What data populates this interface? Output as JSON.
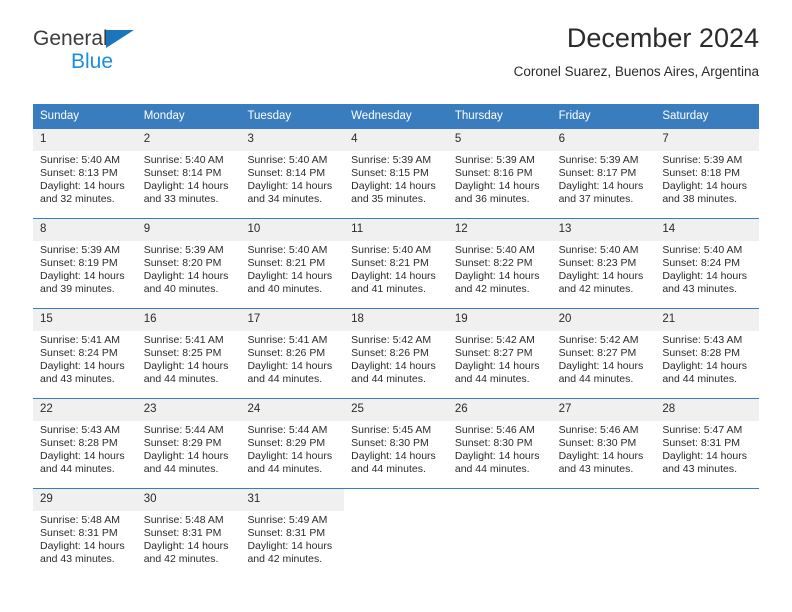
{
  "logo": {
    "word_one": "General",
    "word_two": "Blue",
    "triangle_icon": "triangle-icon",
    "accent_dark": "#3c3c3c",
    "accent_blue": "#1b8ede"
  },
  "header": {
    "title": "December 2024",
    "subtitle": "Coronel Suarez, Buenos Aires, Argentina"
  },
  "colors": {
    "header_blue": "#3a7dbf",
    "day_number_bg": "#f0f0f0",
    "text": "#2b2b2b"
  },
  "calendar": {
    "weekdays": [
      "Sunday",
      "Monday",
      "Tuesday",
      "Wednesday",
      "Thursday",
      "Friday",
      "Saturday"
    ],
    "labels": {
      "sunrise": "Sunrise:",
      "sunset": "Sunset:",
      "daylight": "Daylight:"
    },
    "weeks": [
      [
        {
          "day": "1",
          "sunrise": "Sunrise: 5:40 AM",
          "sunset": "Sunset: 8:13 PM",
          "daylight_line1": "Daylight: 14 hours",
          "daylight_line2": "and 32 minutes."
        },
        {
          "day": "2",
          "sunrise": "Sunrise: 5:40 AM",
          "sunset": "Sunset: 8:14 PM",
          "daylight_line1": "Daylight: 14 hours",
          "daylight_line2": "and 33 minutes."
        },
        {
          "day": "3",
          "sunrise": "Sunrise: 5:40 AM",
          "sunset": "Sunset: 8:14 PM",
          "daylight_line1": "Daylight: 14 hours",
          "daylight_line2": "and 34 minutes."
        },
        {
          "day": "4",
          "sunrise": "Sunrise: 5:39 AM",
          "sunset": "Sunset: 8:15 PM",
          "daylight_line1": "Daylight: 14 hours",
          "daylight_line2": "and 35 minutes."
        },
        {
          "day": "5",
          "sunrise": "Sunrise: 5:39 AM",
          "sunset": "Sunset: 8:16 PM",
          "daylight_line1": "Daylight: 14 hours",
          "daylight_line2": "and 36 minutes."
        },
        {
          "day": "6",
          "sunrise": "Sunrise: 5:39 AM",
          "sunset": "Sunset: 8:17 PM",
          "daylight_line1": "Daylight: 14 hours",
          "daylight_line2": "and 37 minutes."
        },
        {
          "day": "7",
          "sunrise": "Sunrise: 5:39 AM",
          "sunset": "Sunset: 8:18 PM",
          "daylight_line1": "Daylight: 14 hours",
          "daylight_line2": "and 38 minutes."
        }
      ],
      [
        {
          "day": "8",
          "sunrise": "Sunrise: 5:39 AM",
          "sunset": "Sunset: 8:19 PM",
          "daylight_line1": "Daylight: 14 hours",
          "daylight_line2": "and 39 minutes."
        },
        {
          "day": "9",
          "sunrise": "Sunrise: 5:39 AM",
          "sunset": "Sunset: 8:20 PM",
          "daylight_line1": "Daylight: 14 hours",
          "daylight_line2": "and 40 minutes."
        },
        {
          "day": "10",
          "sunrise": "Sunrise: 5:40 AM",
          "sunset": "Sunset: 8:21 PM",
          "daylight_line1": "Daylight: 14 hours",
          "daylight_line2": "and 40 minutes."
        },
        {
          "day": "11",
          "sunrise": "Sunrise: 5:40 AM",
          "sunset": "Sunset: 8:21 PM",
          "daylight_line1": "Daylight: 14 hours",
          "daylight_line2": "and 41 minutes."
        },
        {
          "day": "12",
          "sunrise": "Sunrise: 5:40 AM",
          "sunset": "Sunset: 8:22 PM",
          "daylight_line1": "Daylight: 14 hours",
          "daylight_line2": "and 42 minutes."
        },
        {
          "day": "13",
          "sunrise": "Sunrise: 5:40 AM",
          "sunset": "Sunset: 8:23 PM",
          "daylight_line1": "Daylight: 14 hours",
          "daylight_line2": "and 42 minutes."
        },
        {
          "day": "14",
          "sunrise": "Sunrise: 5:40 AM",
          "sunset": "Sunset: 8:24 PM",
          "daylight_line1": "Daylight: 14 hours",
          "daylight_line2": "and 43 minutes."
        }
      ],
      [
        {
          "day": "15",
          "sunrise": "Sunrise: 5:41 AM",
          "sunset": "Sunset: 8:24 PM",
          "daylight_line1": "Daylight: 14 hours",
          "daylight_line2": "and 43 minutes."
        },
        {
          "day": "16",
          "sunrise": "Sunrise: 5:41 AM",
          "sunset": "Sunset: 8:25 PM",
          "daylight_line1": "Daylight: 14 hours",
          "daylight_line2": "and 44 minutes."
        },
        {
          "day": "17",
          "sunrise": "Sunrise: 5:41 AM",
          "sunset": "Sunset: 8:26 PM",
          "daylight_line1": "Daylight: 14 hours",
          "daylight_line2": "and 44 minutes."
        },
        {
          "day": "18",
          "sunrise": "Sunrise: 5:42 AM",
          "sunset": "Sunset: 8:26 PM",
          "daylight_line1": "Daylight: 14 hours",
          "daylight_line2": "and 44 minutes."
        },
        {
          "day": "19",
          "sunrise": "Sunrise: 5:42 AM",
          "sunset": "Sunset: 8:27 PM",
          "daylight_line1": "Daylight: 14 hours",
          "daylight_line2": "and 44 minutes."
        },
        {
          "day": "20",
          "sunrise": "Sunrise: 5:42 AM",
          "sunset": "Sunset: 8:27 PM",
          "daylight_line1": "Daylight: 14 hours",
          "daylight_line2": "and 44 minutes."
        },
        {
          "day": "21",
          "sunrise": "Sunrise: 5:43 AM",
          "sunset": "Sunset: 8:28 PM",
          "daylight_line1": "Daylight: 14 hours",
          "daylight_line2": "and 44 minutes."
        }
      ],
      [
        {
          "day": "22",
          "sunrise": "Sunrise: 5:43 AM",
          "sunset": "Sunset: 8:28 PM",
          "daylight_line1": "Daylight: 14 hours",
          "daylight_line2": "and 44 minutes."
        },
        {
          "day": "23",
          "sunrise": "Sunrise: 5:44 AM",
          "sunset": "Sunset: 8:29 PM",
          "daylight_line1": "Daylight: 14 hours",
          "daylight_line2": "and 44 minutes."
        },
        {
          "day": "24",
          "sunrise": "Sunrise: 5:44 AM",
          "sunset": "Sunset: 8:29 PM",
          "daylight_line1": "Daylight: 14 hours",
          "daylight_line2": "and 44 minutes."
        },
        {
          "day": "25",
          "sunrise": "Sunrise: 5:45 AM",
          "sunset": "Sunset: 8:30 PM",
          "daylight_line1": "Daylight: 14 hours",
          "daylight_line2": "and 44 minutes."
        },
        {
          "day": "26",
          "sunrise": "Sunrise: 5:46 AM",
          "sunset": "Sunset: 8:30 PM",
          "daylight_line1": "Daylight: 14 hours",
          "daylight_line2": "and 44 minutes."
        },
        {
          "day": "27",
          "sunrise": "Sunrise: 5:46 AM",
          "sunset": "Sunset: 8:30 PM",
          "daylight_line1": "Daylight: 14 hours",
          "daylight_line2": "and 43 minutes."
        },
        {
          "day": "28",
          "sunrise": "Sunrise: 5:47 AM",
          "sunset": "Sunset: 8:31 PM",
          "daylight_line1": "Daylight: 14 hours",
          "daylight_line2": "and 43 minutes."
        }
      ],
      [
        {
          "day": "29",
          "sunrise": "Sunrise: 5:48 AM",
          "sunset": "Sunset: 8:31 PM",
          "daylight_line1": "Daylight: 14 hours",
          "daylight_line2": "and 43 minutes."
        },
        {
          "day": "30",
          "sunrise": "Sunrise: 5:48 AM",
          "sunset": "Sunset: 8:31 PM",
          "daylight_line1": "Daylight: 14 hours",
          "daylight_line2": "and 42 minutes."
        },
        {
          "day": "31",
          "sunrise": "Sunrise: 5:49 AM",
          "sunset": "Sunset: 8:31 PM",
          "daylight_line1": "Daylight: 14 hours",
          "daylight_line2": "and 42 minutes."
        },
        {
          "day": "",
          "sunrise": "",
          "sunset": "",
          "daylight_line1": "",
          "daylight_line2": ""
        },
        {
          "day": "",
          "sunrise": "",
          "sunset": "",
          "daylight_line1": "",
          "daylight_line2": ""
        },
        {
          "day": "",
          "sunrise": "",
          "sunset": "",
          "daylight_line1": "",
          "daylight_line2": ""
        },
        {
          "day": "",
          "sunrise": "",
          "sunset": "",
          "daylight_line1": "",
          "daylight_line2": ""
        }
      ]
    ]
  }
}
